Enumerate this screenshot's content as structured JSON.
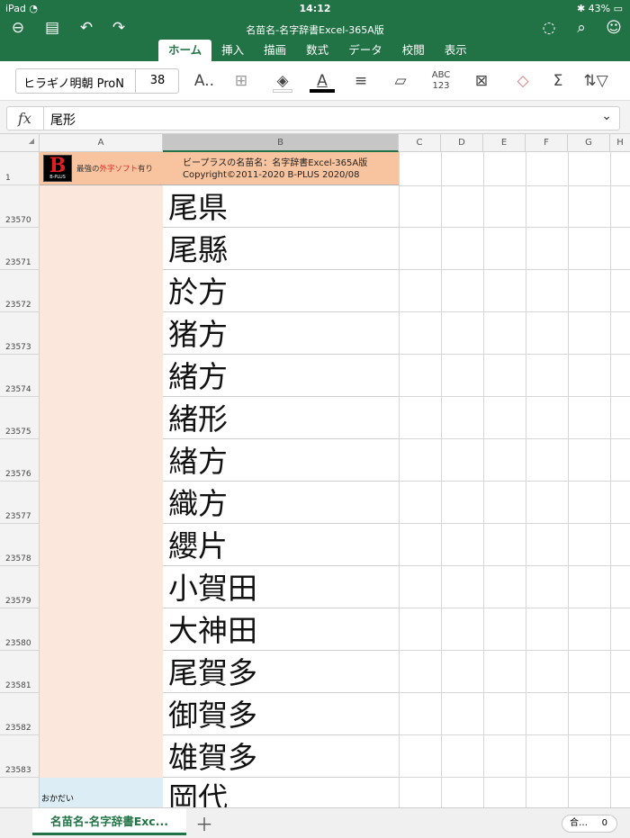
{
  "status": {
    "device": "iPad",
    "time": "14:12",
    "battery": "43%"
  },
  "title": "名苗名-名字辞書Excel-365A版",
  "toolbar_icons": [
    "back-icon",
    "file-icon",
    "undo-icon",
    "redo-icon",
    "lightbulb-icon",
    "search-icon",
    "share-user-icon"
  ],
  "tabs": [
    "ホーム",
    "挿入",
    "描画",
    "数式",
    "データ",
    "校閲",
    "表示"
  ],
  "ribbon": {
    "font_name": "ヒラギノ明朝 ProN",
    "font_size": "38",
    "spell_label_top": "ABC",
    "spell_label_bottom": "123"
  },
  "formula": {
    "label": "fx",
    "value": "尾形"
  },
  "columns": [
    "A",
    "B",
    "C",
    "D",
    "E",
    "F",
    "G",
    "H"
  ],
  "header_row": {
    "row_num": "1",
    "tagline_pre": "最強の",
    "tagline_red": "外字ソフト",
    "tagline_post": "有り",
    "logo_letter": "B",
    "logo_text": "B-PLUS",
    "line1": "ビープラスの名苗名：名字辞書Excel-365A版",
    "line2": "Copyright©2011-2020 B-PLUS 2020/08"
  },
  "rows": [
    {
      "num": "23570",
      "b": "尾県"
    },
    {
      "num": "23571",
      "b": "尾縣"
    },
    {
      "num": "23572",
      "b": "於方"
    },
    {
      "num": "23573",
      "b": "猪方"
    },
    {
      "num": "23574",
      "b": "緒方"
    },
    {
      "num": "23575",
      "b": "緒形"
    },
    {
      "num": "23576",
      "b": "緖方"
    },
    {
      "num": "23577",
      "b": "織方"
    },
    {
      "num": "23578",
      "b": "纓片"
    },
    {
      "num": "23579",
      "b": "小賀田"
    },
    {
      "num": "23580",
      "b": "大神田"
    },
    {
      "num": "23581",
      "b": "尾賀多"
    },
    {
      "num": "23582",
      "b": "御賀多"
    },
    {
      "num": "23583",
      "b": "雄賀多"
    }
  ],
  "next_row": {
    "a": "おかだい",
    "b": "岡代"
  },
  "sheet_tab": "名苗名-名字辞書Exc...",
  "sum": {
    "label": "合…",
    "value": "0"
  }
}
